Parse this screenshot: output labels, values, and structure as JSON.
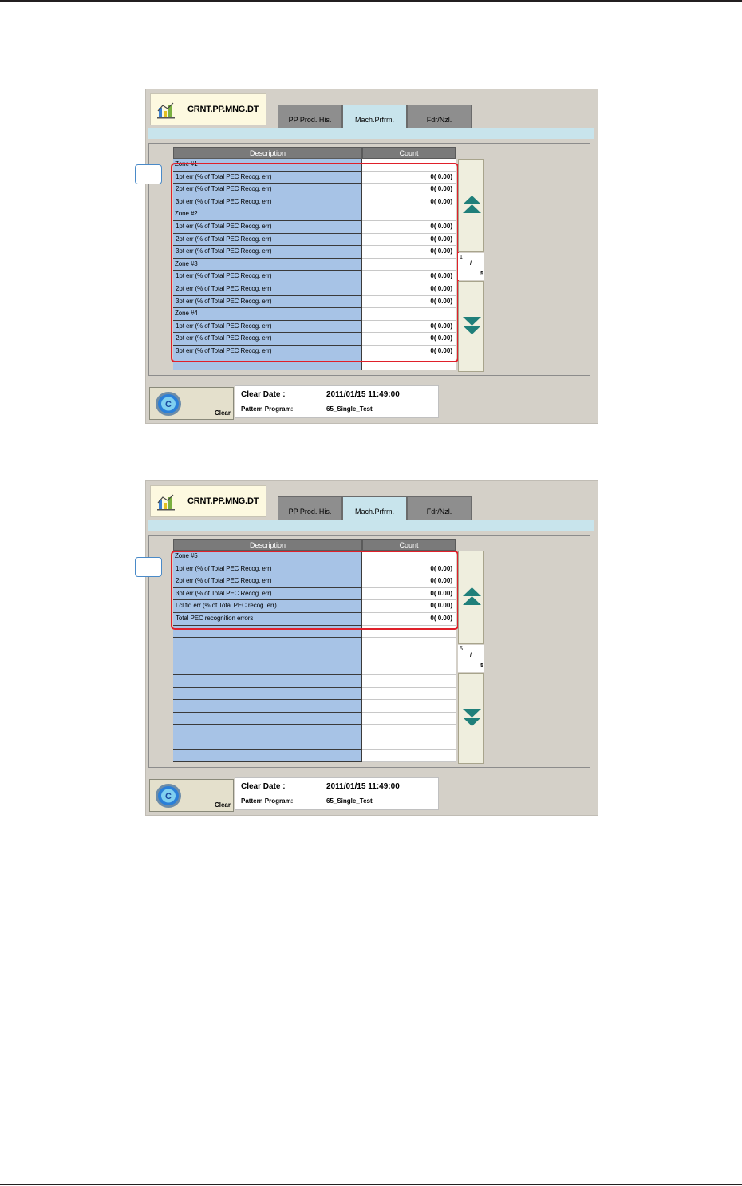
{
  "screens": [
    {
      "title": "CRNT.PP.MNG.DT",
      "tabs": [
        {
          "label": "PP Prod. His.",
          "active": false
        },
        {
          "label": "Mach.Prfrm.",
          "active": true
        },
        {
          "label": "Fdr/Nzl.",
          "active": false
        }
      ],
      "table": {
        "headers": {
          "description": "Description",
          "count": "Count"
        },
        "rows": [
          {
            "desc": "Zone #1",
            "count": "",
            "zone": true
          },
          {
            "desc": "1pt err  (% of Total PEC Recog. err)",
            "count": "0(  0.00)"
          },
          {
            "desc": "2pt err  (% of Total PEC Recog. err)",
            "count": "0(  0.00)"
          },
          {
            "desc": "3pt err  (% of Total PEC Recog. err)",
            "count": "0(  0.00)"
          },
          {
            "desc": "Zone #2",
            "count": "",
            "zone": true
          },
          {
            "desc": "1pt err  (% of Total PEC Recog. err)",
            "count": "0(  0.00)"
          },
          {
            "desc": "2pt err  (% of Total PEC Recog. err)",
            "count": "0(  0.00)"
          },
          {
            "desc": "3pt err  (% of Total PEC Recog. err)",
            "count": "0(  0.00)"
          },
          {
            "desc": "Zone #3",
            "count": "",
            "zone": true
          },
          {
            "desc": "1pt err  (% of Total PEC Recog. err)",
            "count": "0(  0.00)"
          },
          {
            "desc": "2pt err  (% of Total PEC Recog. err)",
            "count": "0(  0.00)"
          },
          {
            "desc": "3pt err  (% of Total PEC Recog. err)",
            "count": "0(  0.00)"
          },
          {
            "desc": "Zone #4",
            "count": "",
            "zone": true
          },
          {
            "desc": "1pt err  (% of Total PEC Recog. err)",
            "count": "0(  0.00)"
          },
          {
            "desc": "2pt err  (% of Total PEC Recog. err)",
            "count": "0(  0.00)"
          },
          {
            "desc": "3pt err  (% of Total PEC Recog. err)",
            "count": "0(  0.00)"
          },
          {
            "desc": "",
            "count": ""
          }
        ]
      },
      "pager": {
        "current": "1",
        "separator": "/",
        "total": "5"
      },
      "clear_label": "Clear",
      "info": {
        "clear_date_label": "Clear Date :",
        "clear_date_value": "2011/01/15 11:49:00",
        "pattern_label": "Pattern Program:",
        "pattern_value": "65_Single_Test"
      }
    },
    {
      "title": "CRNT.PP.MNG.DT",
      "tabs": [
        {
          "label": "PP Prod. His.",
          "active": false
        },
        {
          "label": "Mach.Prfrm.",
          "active": true
        },
        {
          "label": "Fdr/Nzl.",
          "active": false
        }
      ],
      "table": {
        "headers": {
          "description": "Description",
          "count": "Count"
        },
        "rows": [
          {
            "desc": "Zone #5",
            "count": "",
            "zone": true
          },
          {
            "desc": "1pt err  (% of Total PEC Recog. err)",
            "count": "0(  0.00)"
          },
          {
            "desc": "2pt err  (% of Total PEC Recog. err)",
            "count": "0(  0.00)"
          },
          {
            "desc": "3pt err  (% of Total PEC Recog. err)",
            "count": "0(  0.00)"
          },
          {
            "desc": "Lcl fid.err (% of Total PEC recog. err)",
            "count": "0(  0.00)"
          },
          {
            "desc": "Total PEC recognition errors",
            "count": "0(  0.00)"
          },
          {
            "desc": "",
            "count": ""
          },
          {
            "desc": "",
            "count": ""
          },
          {
            "desc": "",
            "count": ""
          },
          {
            "desc": "",
            "count": ""
          },
          {
            "desc": "",
            "count": ""
          },
          {
            "desc": "",
            "count": ""
          },
          {
            "desc": "",
            "count": ""
          },
          {
            "desc": "",
            "count": ""
          },
          {
            "desc": "",
            "count": ""
          },
          {
            "desc": "",
            "count": ""
          },
          {
            "desc": "",
            "count": ""
          }
        ]
      },
      "pager": {
        "current": "5",
        "separator": "/",
        "total": "5"
      },
      "clear_label": "Clear",
      "info": {
        "clear_date_label": "Clear Date :",
        "clear_date_value": "2011/01/15 11:49:00",
        "pattern_label": "Pattern Program:",
        "pattern_value": "65_Single_Test"
      }
    }
  ],
  "colors": {
    "highlight_frame": "#e0202a",
    "desc_cell": "#a7c3e6",
    "active_tab": "#c8e4ec",
    "arrow_teal": "#1f7f7a"
  },
  "icons": [
    "chart-icon",
    "scroll-up-icon",
    "scroll-down-icon",
    "clear-icon"
  ]
}
